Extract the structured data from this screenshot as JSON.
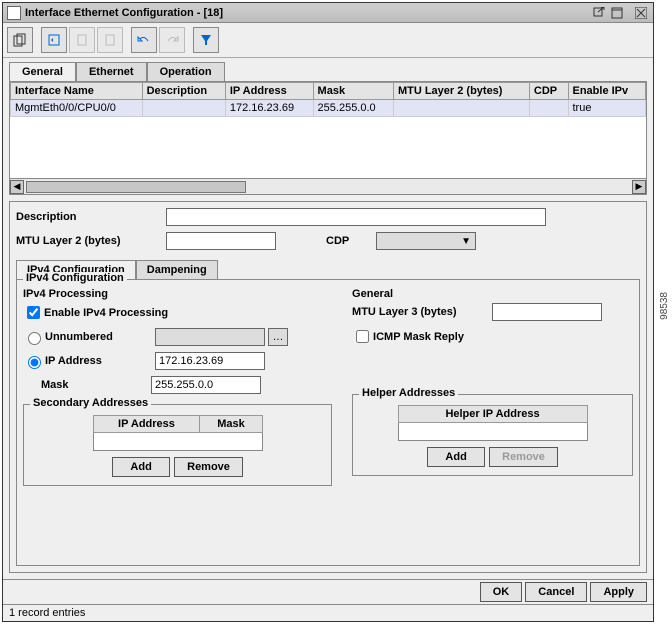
{
  "window": {
    "title": "Interface Ethernet Configuration - [18]"
  },
  "tabs": {
    "general": "General",
    "ethernet": "Ethernet",
    "operation": "Operation"
  },
  "columns": {
    "ifname": "Interface Name",
    "desc": "Description",
    "ip": "IP Address",
    "mask": "Mask",
    "mtu2": "MTU Layer 2 (bytes)",
    "cdp": "CDP",
    "enipv": "Enable IPv"
  },
  "rows": [
    {
      "ifname": "MgmtEth0/0/CPU0/0",
      "desc": "",
      "ip": "172.16.23.69",
      "mask": "255.255.0.0",
      "mtu2": "",
      "cdp": "",
      "enipv": "true"
    }
  ],
  "form": {
    "desc_label": "Description",
    "mtu2_label": "MTU Layer 2 (bytes)",
    "cdp_label": "CDP"
  },
  "subtabs": {
    "ipv4": "IPv4 Configuration",
    "damp": "Dampening"
  },
  "ipv4": {
    "legend": "IPv4 Configuration",
    "proc_legend": "IPv4 Processing",
    "enable_label": "Enable IPv4 Processing",
    "unnum_label": "Unnumbered",
    "ipaddr_label": "IP Address",
    "mask_label": "Mask",
    "ip_value": "172.16.23.69",
    "mask_value": "255.255.0.0",
    "sec_legend": "Secondary Addresses",
    "sec_ip_col": "IP Address",
    "sec_mask_col": "Mask",
    "add": "Add",
    "remove": "Remove",
    "gen_legend": "General",
    "mtu3_label": "MTU Layer 3 (bytes)",
    "icmp_label": "ICMP Mask Reply",
    "helper_legend": "Helper Addresses",
    "helper_col": "Helper IP Address"
  },
  "footer": {
    "ok": "OK",
    "cancel": "Cancel",
    "apply": "Apply"
  },
  "status": "1 record entries",
  "sidenum": "98538"
}
